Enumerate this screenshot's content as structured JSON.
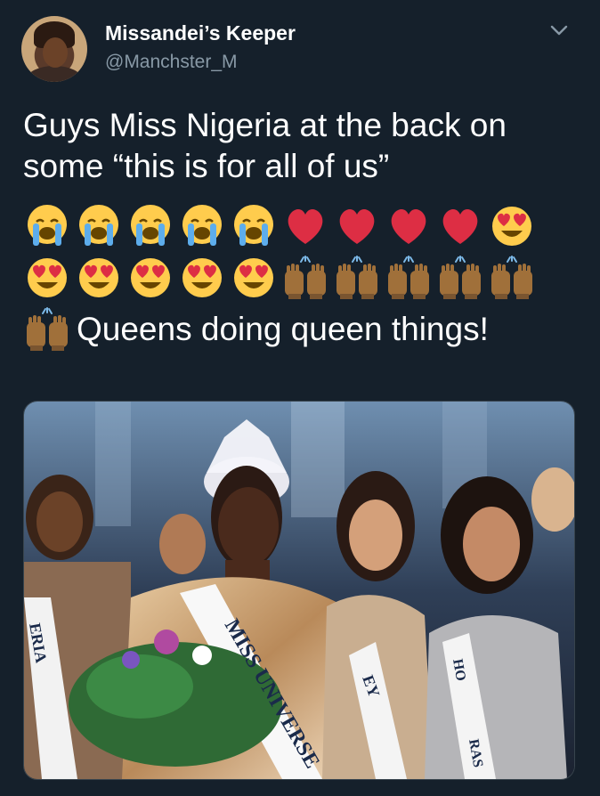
{
  "tweet": {
    "author_name": "Missandei’s Keeper",
    "author_handle": "@Manchster_M",
    "text_line": "Guys Miss Nigeria at the back on some “this is for all of us”",
    "text_end": "Queens doing queen things!",
    "emoji_row1": [
      "crying-face",
      "crying-face",
      "crying-face",
      "crying-face",
      "crying-face",
      "red-heart",
      "red-heart",
      "red-heart",
      "red-heart",
      "heart-eyes-face"
    ],
    "emoji_row2": [
      "heart-eyes-face",
      "heart-eyes-face",
      "heart-eyes-face",
      "heart-eyes-face",
      "heart-eyes-face",
      "raising-hands",
      "raising-hands",
      "raising-hands",
      "raising-hands",
      "raising-hands"
    ],
    "emoji_row3": [
      "raising-hands"
    ]
  },
  "media": {
    "sash_main": "MISS UNIVERSE",
    "sash_left": "ERIA",
    "sash_mid": "EY",
    "sash_right_top": "HO",
    "sash_right_bottom": "RAS"
  },
  "colors": {
    "background": "#15202b",
    "secondary_text": "#8899a6",
    "heart": "#dd2e44",
    "face_yellow": "#ffcc4d",
    "hands_skin": "#a0703a"
  }
}
